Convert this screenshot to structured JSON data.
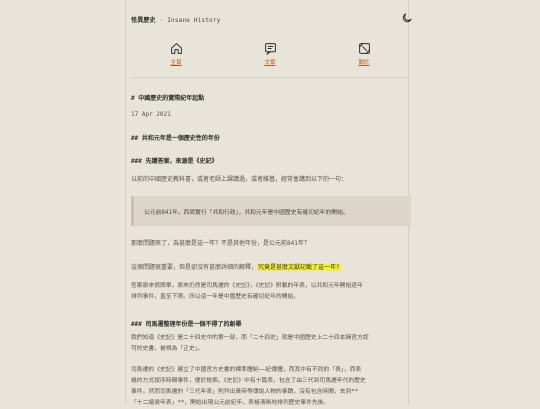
{
  "header": {
    "site_title": "怪異歷史",
    "site_subtitle": " · Insane History"
  },
  "nav": {
    "items": [
      {
        "label": "主頁",
        "icon": "home-icon"
      },
      {
        "label": "文章",
        "icon": "article-icon"
      },
      {
        "label": "關於",
        "icon": "about-icon"
      }
    ]
  },
  "article": {
    "h1": "# 中國歷史的實際紀年起點",
    "date": "17 Apr 2021",
    "h2": "## 共和元年是一個歷史性的年份",
    "h3a": "### 先講答案，來源是《史記》",
    "p1": "以前的中國歷史教科書，或者老師上課講過，或者維基，經常會講到以下的一句：",
    "quote": "公元前841年，西周實行「共和行政」，共和元年是中國歷史有確切紀年的開始。",
    "p2": "那麼問題來了，為甚麼是這一年？不是其他年份，是公元前841年？",
    "p3_pre": "這個問題很重要，但是卻沒有甚麼詳細的解釋，",
    "p3_mark": "究竟是甚麼文獻記載了這一年?",
    "p4_l1": "答案原來很簡單，原來仍然是司馬遷的《史記》，《史記》附載的年表，以共和元年開始逐年",
    "p4_l2": "排列事件，直至下限。所以這一年是中國歷史有確切紀年的開始。",
    "h3b": "### 司馬遷整理年份是一個不得了的創舉",
    "p5_l1": "我們知道《史記》是二十四史中的第一部，而「二十四史」就是中國歷史上二十四本擁官方認",
    "p5_l2": "可的史書，被視為「正史」。",
    "p6_l1": "司馬遷的《史記》建立了中國官方史書的標準體制——紀傳體，而其中有不同的「表」，而表",
    "p6_l2": "格的方式按序時間事件，便於檢索。《史記》中有十篇表，包含了由三代到司馬遷年代的歷史",
    "p6_l3": "事件。然而司馬遷的「三代年表」則列出黃帝等傳說人物的事蹟，沒有包含時間，去到**",
    "p6_l4": "「十二諸侯年表」**，開始出現公元前紀年，表格清晰地排列歷史事件先後。"
  },
  "colors": {
    "background": "#e9e4da",
    "accent": "#b25a1c",
    "highlight": "#f5f03a",
    "quote_bg": "#ddd6c8"
  }
}
